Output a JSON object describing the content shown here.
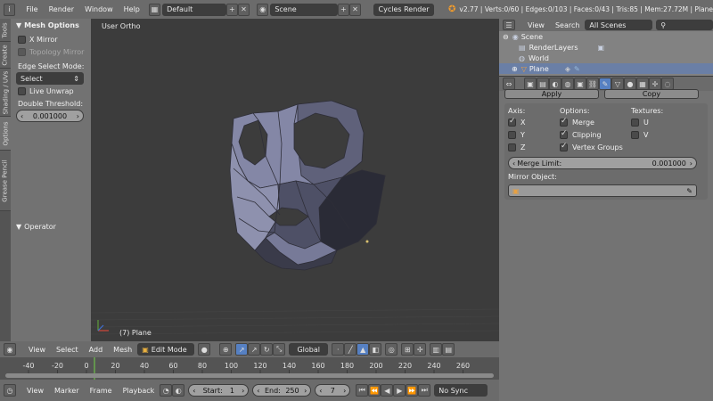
{
  "topbar": {
    "menus": [
      "File",
      "Render",
      "Window",
      "Help"
    ],
    "layout": "Default",
    "scene": "Scene",
    "engine": "Cycles Render",
    "stats": "v2.77 | Verts:0/60 | Edges:0/103 | Faces:0/43 | Tris:85 | Mem:27.72M | Plane"
  },
  "shelf": {
    "tabs": [
      "Tools",
      "Create",
      "Shading / UVs",
      "Options",
      "Grease Pencil"
    ],
    "mesh_options": "Mesh Options",
    "x_mirror": "X Mirror",
    "topology_mirror": "Topology Mirror",
    "edge_select_mode": "Edge Select Mode:",
    "select": "Select",
    "live_unwrap": "Live Unwrap",
    "double_threshold": "Double Threshold:",
    "threshold_value": "0.001000",
    "operator": "Operator"
  },
  "viewport": {
    "label": "User Ortho",
    "object": "(7) Plane"
  },
  "view_header": {
    "menus": [
      "View",
      "Select",
      "Add",
      "Mesh"
    ],
    "mode": "Edit Mode",
    "orientation": "Global"
  },
  "timeline": {
    "ticks": [
      "-40",
      "-20",
      "0",
      "20",
      "40",
      "60",
      "80",
      "100",
      "120",
      "140",
      "160",
      "180",
      "200",
      "220",
      "240",
      "260"
    ],
    "menus": [
      "View",
      "Marker",
      "Frame",
      "Playback"
    ],
    "start_label": "Start:",
    "start": "1",
    "end_label": "End:",
    "end": "250",
    "current": "7",
    "sync": "No Sync"
  },
  "outliner": {
    "menus": [
      "View",
      "Search"
    ],
    "filter": "All Scenes",
    "items": [
      "Scene",
      "RenderLayers",
      "World",
      "Plane"
    ]
  },
  "properties": {
    "apply": "Apply",
    "copy": "Copy",
    "axis": "Axis:",
    "options": "Options:",
    "textures": "Textures:",
    "x": "X",
    "y": "Y",
    "z": "Z",
    "merge": "Merge",
    "clipping": "Clipping",
    "vertex_groups": "Vertex Groups",
    "u": "U",
    "v": "V",
    "merge_limit": "Merge Limit:",
    "merge_limit_value": "0.001000",
    "mirror_object": "Mirror Object:"
  }
}
